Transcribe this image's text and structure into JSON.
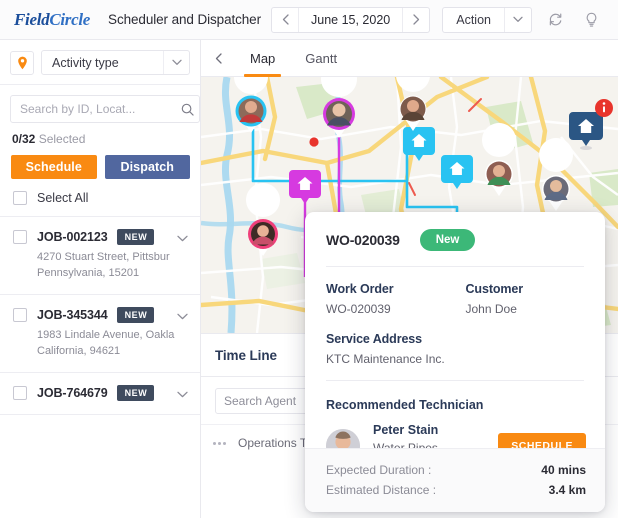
{
  "topbar": {
    "logo_part1": "Field",
    "logo_part2": "Circle",
    "app_title": "Scheduler and Dispatcher",
    "prev_icon": "chevron-left-icon",
    "date_value": "June 15, 2020",
    "next_icon": "chevron-right-icon",
    "action_label": "Action",
    "action_chevron": "chevron-down-icon",
    "refresh_icon": "refresh-icon",
    "bulb_icon": "lightbulb-icon"
  },
  "sidebar": {
    "pin_icon": "map-pin-icon",
    "activity_type_label": "Activity type",
    "activity_chevron": "chevron-down-icon",
    "search_placeholder": "Search by ID, Locat...",
    "search_value": "",
    "search_icon": "search-icon",
    "filter_icon": "funnel-filter-icon",
    "selected_count": "0/32",
    "selected_suffix": "Selected",
    "schedule_button": "Schedule",
    "dispatch_button": "Dispatch",
    "select_all_label": "Select All",
    "jobs": [
      {
        "id": "JOB-002123",
        "badge": "NEW",
        "address_line1": "4270 Stuart Street, Pittsbur",
        "address_line2": "Pennsylvania, 15201"
      },
      {
        "id": "JOB-345344",
        "badge": "NEW",
        "address_line1": "1983 Lindale Avenue, Oakla",
        "address_line2": "California, 94621"
      },
      {
        "id": "JOB-764679",
        "badge": "NEW",
        "address_line1": "",
        "address_line2": ""
      }
    ]
  },
  "map_panel": {
    "back_icon": "chevron-left-icon",
    "tabs": [
      {
        "label": "Map",
        "active": true
      },
      {
        "label": "Gantt",
        "active": false
      }
    ],
    "map_colors": {
      "land": "#f5f3ee",
      "water": "#a9d8ef",
      "major_road": "#f8d77b",
      "minor_road": "#ffffff",
      "park": "#d7e8c6",
      "route_cyan": "#29c3f2",
      "route_magenta": "#d63ae0",
      "marker_navy": "#2b5684",
      "marker_red": "#e8342c"
    }
  },
  "timeline": {
    "title": "Time Line",
    "search_placeholder": "Search Agent",
    "search_value": "",
    "search_icon": "search-icon",
    "menu_icon": "dots-menu-icon",
    "team_name": "Operations Team"
  },
  "popup": {
    "work_order_number": "WO-020039",
    "status_badge": "New",
    "status_badge_color": "#3cb878",
    "fields": [
      {
        "label": "Work Order",
        "value": "WO-020039"
      },
      {
        "label": "Customer",
        "value": "John Doe"
      }
    ],
    "service_address_label": "Service Address",
    "service_address_value": "KTC Maintenance Inc.",
    "recommended_label": "Recommended Technician",
    "technician": {
      "avatar": "technician-photo",
      "name": "Peter Stain",
      "role": "Water Pipes Installation"
    },
    "schedule_button": "SCHEDULE",
    "footer": [
      {
        "label": "Expected Duration :",
        "value": "40 mins"
      },
      {
        "label": "Estimated Distance :",
        "value": "3.4 km"
      }
    ]
  }
}
